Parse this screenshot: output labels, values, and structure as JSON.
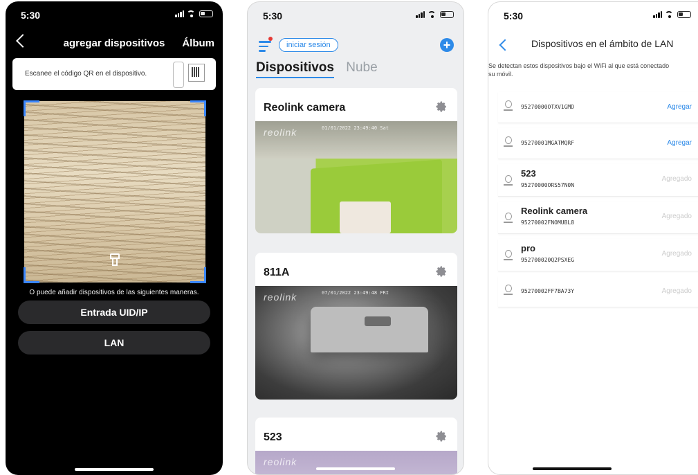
{
  "phone1": {
    "status": {
      "time": "5:30"
    },
    "header": {
      "title": "agregar dispositivos",
      "album": "Álbum"
    },
    "qr_hint": "Escanee el código QR en el dispositivo.",
    "other_ways": "O puede añadir dispositivos de las siguientes maneras.",
    "buttons": {
      "uid": "Entrada UID/IP",
      "lan": "LAN"
    }
  },
  "phone2": {
    "status": {
      "time": "5:30"
    },
    "login_label": "iniciar sesión",
    "tabs": [
      "Dispositivos",
      "Nube"
    ],
    "cards": [
      {
        "title": "Reolink camera",
        "logo": "reolink",
        "timestamp": "01/01/2022 23:49:40 Sat"
      },
      {
        "title": "811A",
        "logo": "reolink",
        "timestamp": "07/01/2022 23:49:48 FRI"
      },
      {
        "title": "523",
        "logo": "reolink",
        "timestamp": ""
      }
    ]
  },
  "phone3": {
    "status": {
      "time": "5:30"
    },
    "title": "Dispositivos en el ámbito de LAN",
    "description": "Se detectan estos dispositivos bajo el WiFi al que está conectado su móvil.",
    "devices": [
      {
        "name": "",
        "uid": "95270000OTXV1GMD",
        "action": "Agregar"
      },
      {
        "name": "",
        "uid": "95270001MGATMQRF",
        "action": "Agregar"
      },
      {
        "name": "523",
        "uid": "95270000ORS57N0N",
        "action": "Agregado"
      },
      {
        "name": "Reolink camera",
        "uid": "95270002FNOMUBL8",
        "action": "Agregado"
      },
      {
        "name": "pro",
        "uid": "952700020Q2PSXEG",
        "action": "Agregado"
      },
      {
        "name": "",
        "uid": "95270002FF7BA73Y",
        "action": "Agregado"
      }
    ]
  },
  "colors": {
    "accent": "#2d8ae8",
    "scan_corner": "#3a86ff",
    "added_gray": "#cccccc"
  }
}
